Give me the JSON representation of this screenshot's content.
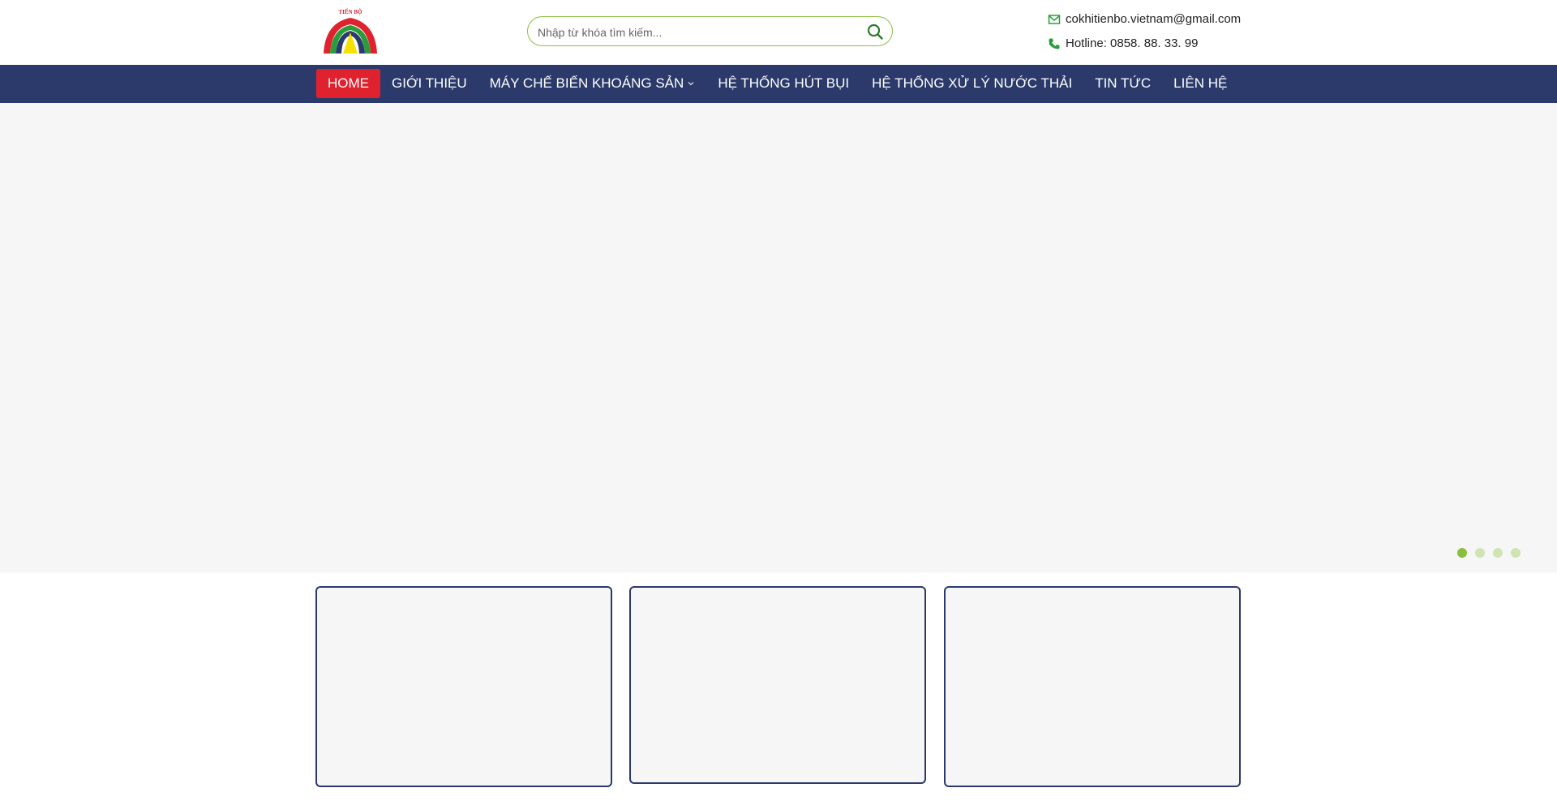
{
  "brand": {
    "logo_text": "TIẾN BỘ",
    "colors": {
      "red": "#e0222f",
      "green": "#2a9d3a",
      "navy": "#2b3a6b",
      "yellow": "#f5e000",
      "accent_green": "#8cbf3f"
    }
  },
  "search": {
    "placeholder": "Nhập từ khóa tìm kiếm...",
    "icon": "search-icon"
  },
  "contact": {
    "email": "cokhitienbo.vietnam@gmail.com",
    "email_icon": "envelope-icon",
    "phone": "Hotline: 0858. 88. 33. 99",
    "phone_icon": "phone-icon"
  },
  "nav": {
    "items": [
      {
        "label": "HOME",
        "active": true
      },
      {
        "label": "GIỚI THIỆU"
      },
      {
        "label": "MÁY CHẾ BIẾN KHOÁNG SẢN",
        "has_dropdown": true
      },
      {
        "label": "HỆ THỐNG HÚT BỤI"
      },
      {
        "label": "HỆ THỐNG XỬ LÝ NƯỚC THẢI"
      },
      {
        "label": "TIN TỨC"
      },
      {
        "label": "LIÊN HỆ"
      }
    ]
  },
  "slider": {
    "slide_count": 4,
    "active_slide": 1
  }
}
